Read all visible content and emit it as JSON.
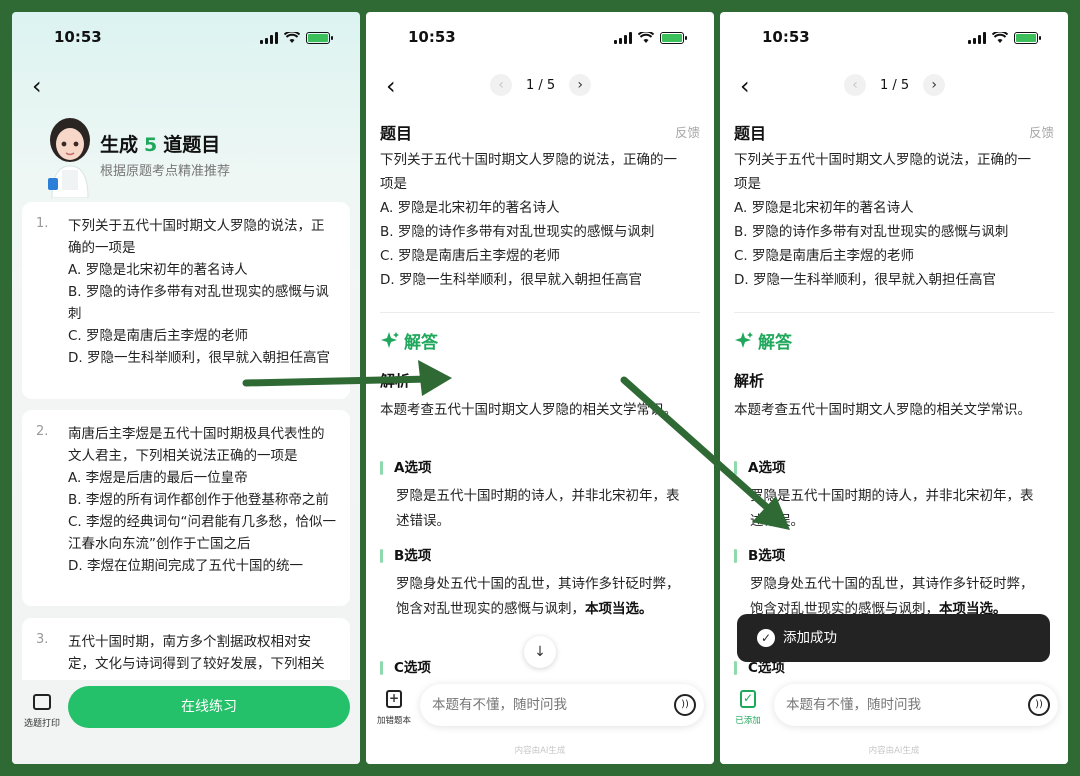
{
  "status_time": "10:53",
  "panel1": {
    "title_prefix": "生成",
    "title_count": "5",
    "title_suffix": "道题目",
    "subtitle": "根据原题考点精准推荐",
    "questions": [
      {
        "num": "1.",
        "text": "下列关于五代十国时期文人罗隐的说法，正确的一项是",
        "options": [
          "A. 罗隐是北宋初年的著名诗人",
          "B. 罗隐的诗作多带有对乱世现实的感慨与讽刺",
          "C. 罗隐是南唐后主李煜的老师",
          "D. 罗隐一生科举顺利，很早就入朝担任高官"
        ]
      },
      {
        "num": "2.",
        "text": "南唐后主李煜是五代十国时期极具代表性的文人君主，下列相关说法正确的一项是",
        "options": [
          "A. 李煜是后唐的最后一位皇帝",
          "B. 李煜的所有词作都创作于他登基称帝之前",
          "C. 李煜的经典词句“问君能有几多愁，恰似一江春水向东流”创作于亡国之后",
          "D. 李煜在位期间完成了五代十国的统一"
        ]
      },
      {
        "num": "3.",
        "text": "五代十国时期，南方多个割据政权相对安定，文化与诗词得到了较好发展，下列相关",
        "options": []
      }
    ],
    "print_label": "选题打印",
    "practice_label": "在线练习"
  },
  "detail": {
    "page_indicator": "1 / 5",
    "section_title": "题目",
    "feedback_label": "反馈",
    "question_text": "下列关于五代十国时期文人罗隐的说法，正确的一项是",
    "options": [
      "A. 罗隐是北宋初年的著名诗人",
      "B. 罗隐的诗作多带有对乱世现实的感慨与讽刺",
      "C. 罗隐是南唐后主李煜的老师",
      "D. 罗隐一生科举顺利，很早就入朝担任高官"
    ],
    "answer_heading": "解答",
    "analysis_title": "解析",
    "analysis_text": "本题考查五代十国时期文人罗隐的相关文学常识。",
    "option_a_label": "A选项",
    "option_a_text": "罗隐是五代十国时期的诗人，并非北宋初年，表述错误。",
    "option_b_label": "B选项",
    "option_b_text": "罗隐身处五代十国的乱世，其诗作多针砭时弊，饱含对乱世现实的感慨与讽刺，",
    "option_b_bold": "本项当选。",
    "option_c_label": "C选项",
    "ask_placeholder": "本题有不懂，随时问我",
    "ai_note": "内容由AI生成",
    "add_wrong_label": "加错题本",
    "added_label": "已添加",
    "toast_text": "添加成功"
  },
  "colors": {
    "accent_green": "#25c06a",
    "arrow_green": "#2f6a35",
    "toast_bg": "#232323"
  }
}
